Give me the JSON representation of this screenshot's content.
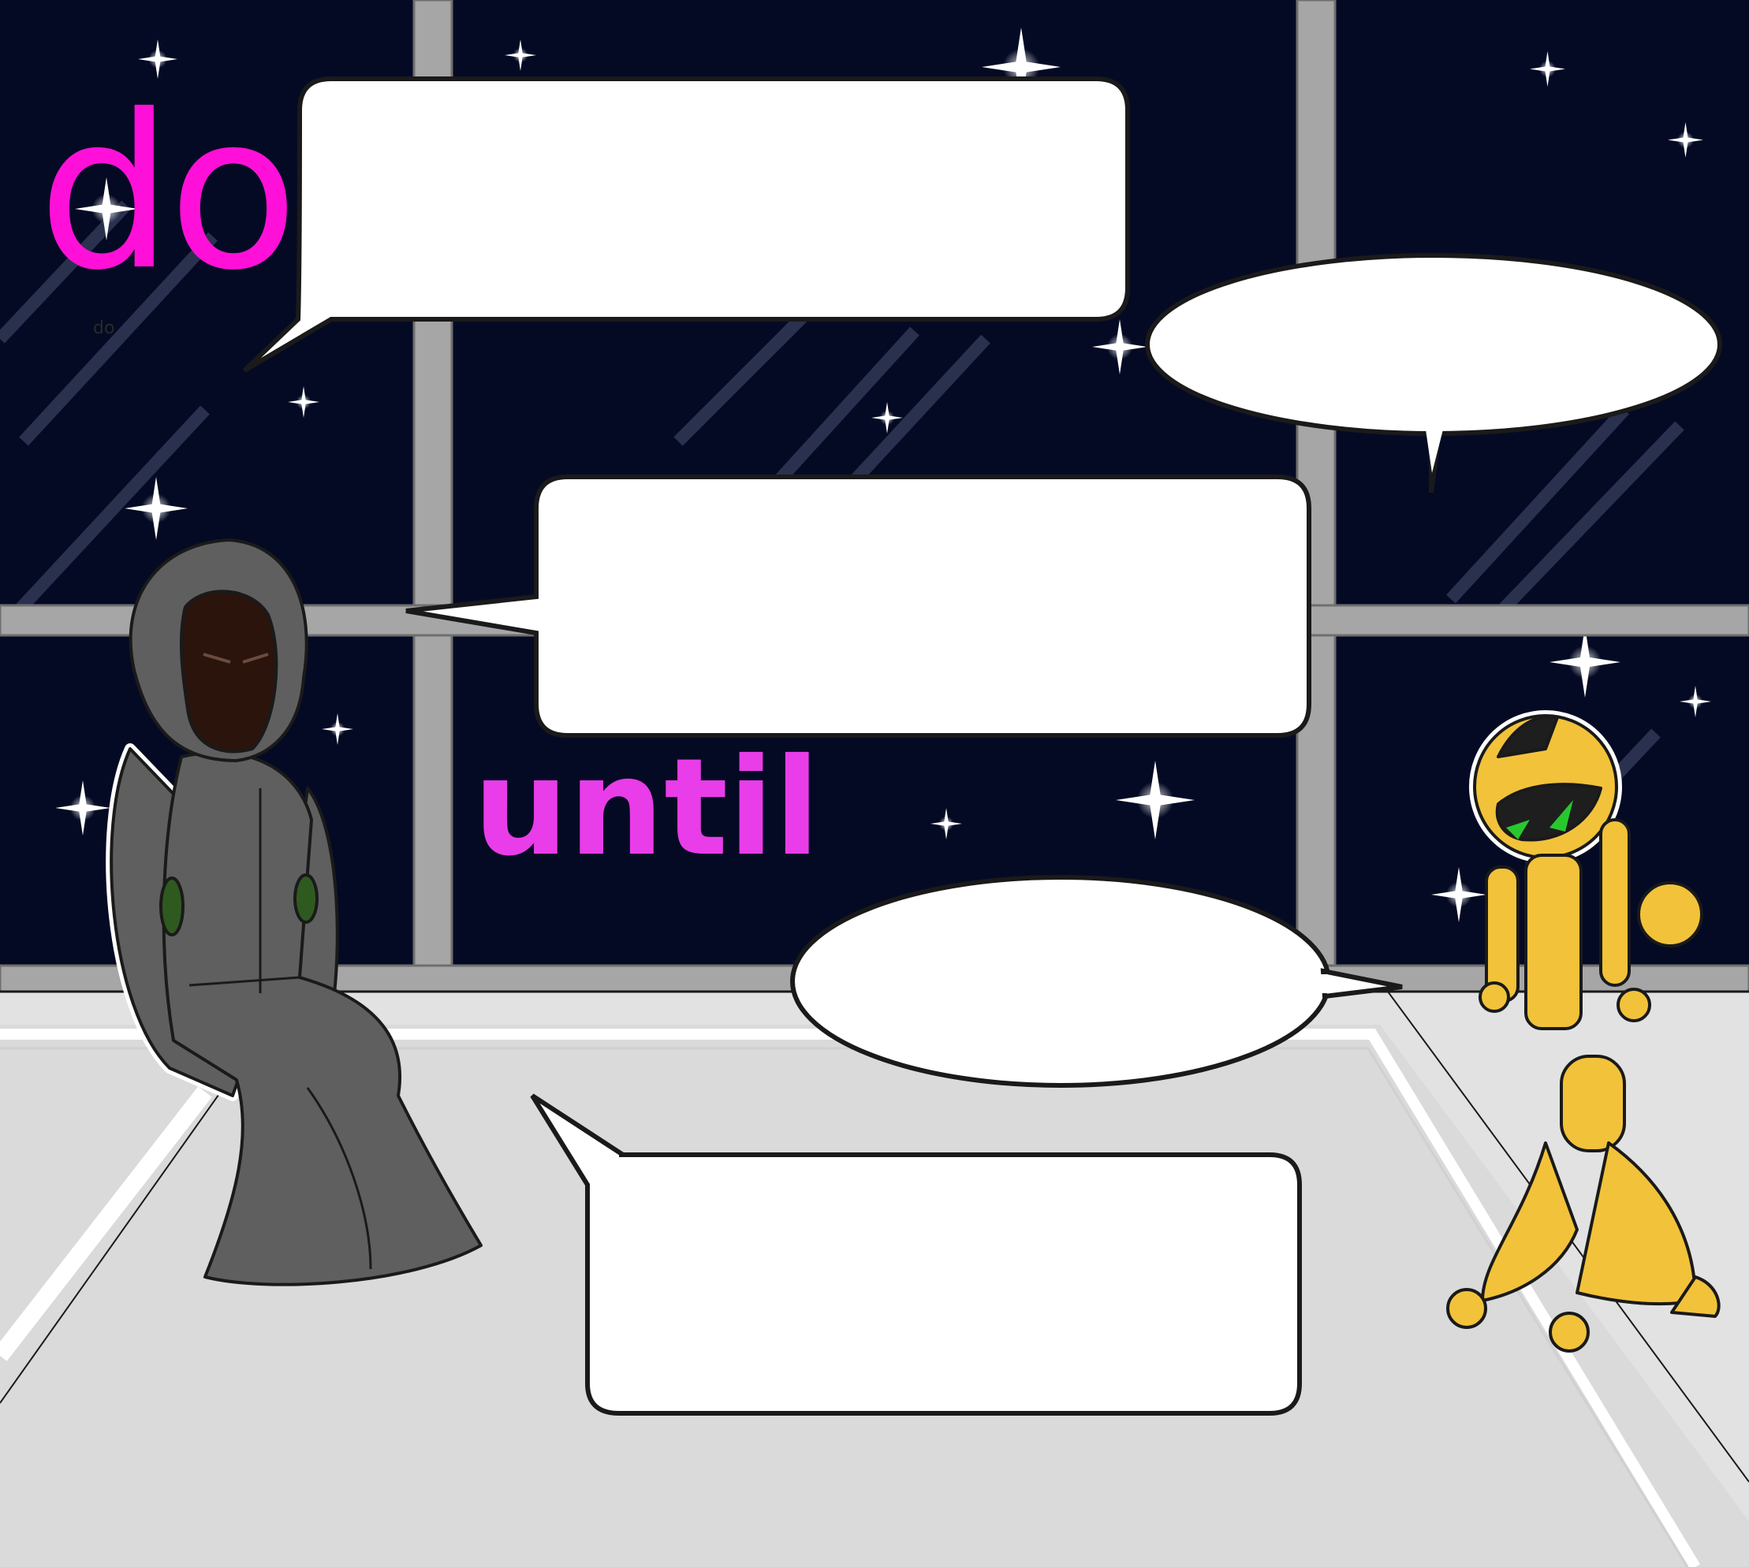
{
  "scene": {
    "labels": {
      "do_large": "do",
      "do_small": "do",
      "until": "until"
    },
    "speech_bubbles": [
      {
        "shape": "rounded-rect",
        "tail": "down-left",
        "text": ""
      },
      {
        "shape": "oval",
        "tail": "down",
        "text": ""
      },
      {
        "shape": "rounded-rect",
        "tail": "left",
        "text": ""
      },
      {
        "shape": "oval",
        "tail": "right",
        "text": ""
      },
      {
        "shape": "rounded-rect",
        "tail": "up-left",
        "text": ""
      }
    ],
    "characters": [
      {
        "name": "hooded-figure",
        "description_icon": "cloaked-figure-icon"
      },
      {
        "name": "yellow-robot",
        "description_icon": "robot-icon"
      }
    ]
  },
  "colors": {
    "space": "#050a24",
    "window_frame": "#a6a6a6",
    "floor": "#e2e2e2",
    "do_text": "#ff10d8",
    "until_text": "#e83de8",
    "robe": "#5f5f5f",
    "robot": "#f2c23a",
    "robot_visor": "#1e1e1e",
    "robot_eye": "#29c72e"
  }
}
